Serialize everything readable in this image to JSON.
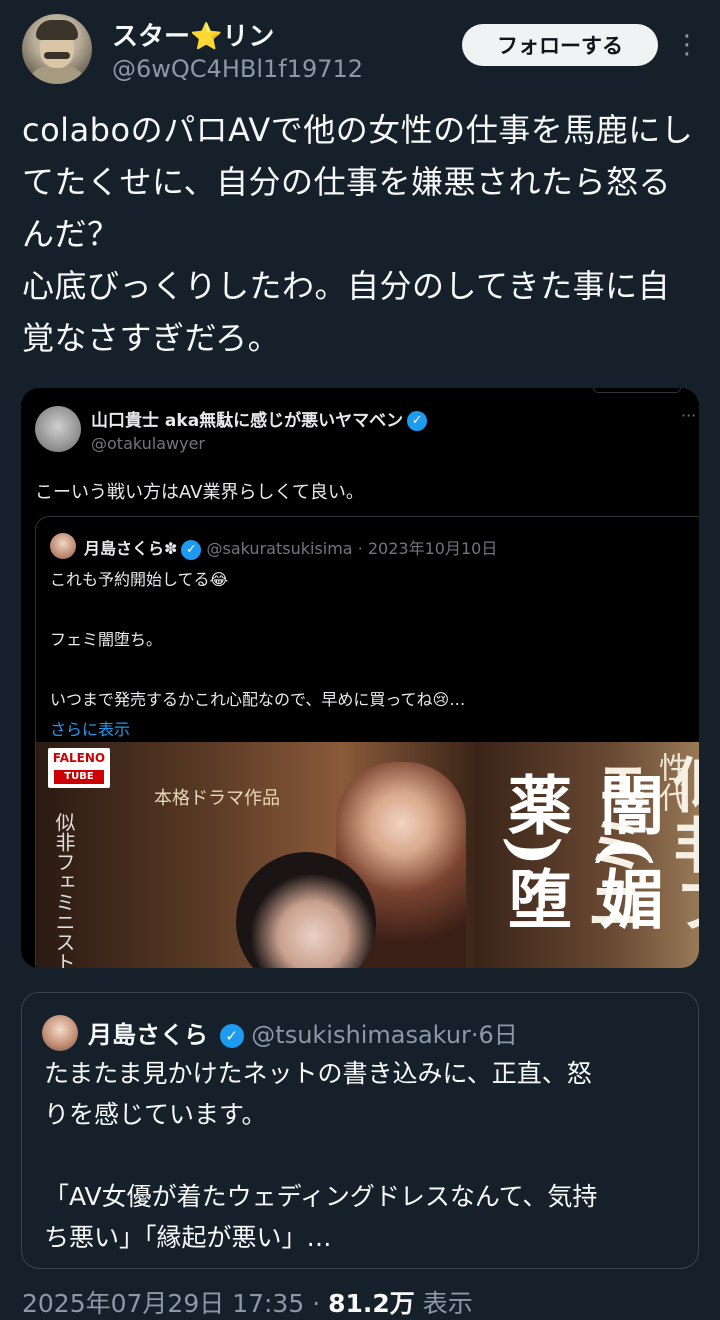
{
  "author": {
    "display_name": "スター⭐リン",
    "handle": "@6wQC4HBl1f19712",
    "follow_label": "フォローする",
    "more_icon": "⋮"
  },
  "tweet": {
    "lines": [
      "colaboのパロAVで他の女性の仕事を馬鹿にし",
      "てたくせに、自分の仕事を嫌悪されたら怒る",
      "んだ？",
      "心底びっくりしたわ。自分のしてきた事に自",
      "覚なさすぎだろ。"
    ]
  },
  "image_card": {
    "quote_author": {
      "name": "山口貴士 aka無駄に感じが悪いヤマベン",
      "handle": "@otakulawyer",
      "more_icon": "···"
    },
    "quote_text": "こーいう戦い方はAV業界らしくて良い。",
    "inner_quote": {
      "name": "月島さくら✽",
      "handle": "@sakuratsukisima",
      "separator": "·",
      "date": "2023年10月10日",
      "line1": "これも予約開始してる😂",
      "line2": "",
      "line3": "フェミ闇堕ち。",
      "line4": "",
      "line5": "いつまで発売するかこれ心配なので、早めに買ってね😢…",
      "show_more": "さらに表示"
    },
    "promo": {
      "logo_top": "FALENO",
      "logo_bottom": "TUBE",
      "subtitle": "本格ドラマ作品",
      "vertical_1": "一般社団法人女性代",
      "vertical_2": "似非フェミニ",
      "vertical_3": "闇(媚薬)堕",
      "vertical_4": "似非フェミニスト"
    }
  },
  "quoted_tweet": {
    "name": "月島さくら",
    "handle": "@tsukishimasakur",
    "separator": "·",
    "date": "6日",
    "lines": [
      "たまたま見かけたネットの書き込みに、正直、怒",
      "りを感じています。",
      "",
      "「AV女優が着たウェディングドレスなんて、気持",
      "ち悪い」「縁起が悪い」…"
    ]
  },
  "meta": {
    "datetime": "2025年07月29日 17:35",
    "separator": "·",
    "views": "81.2万",
    "views_label": "表示"
  }
}
